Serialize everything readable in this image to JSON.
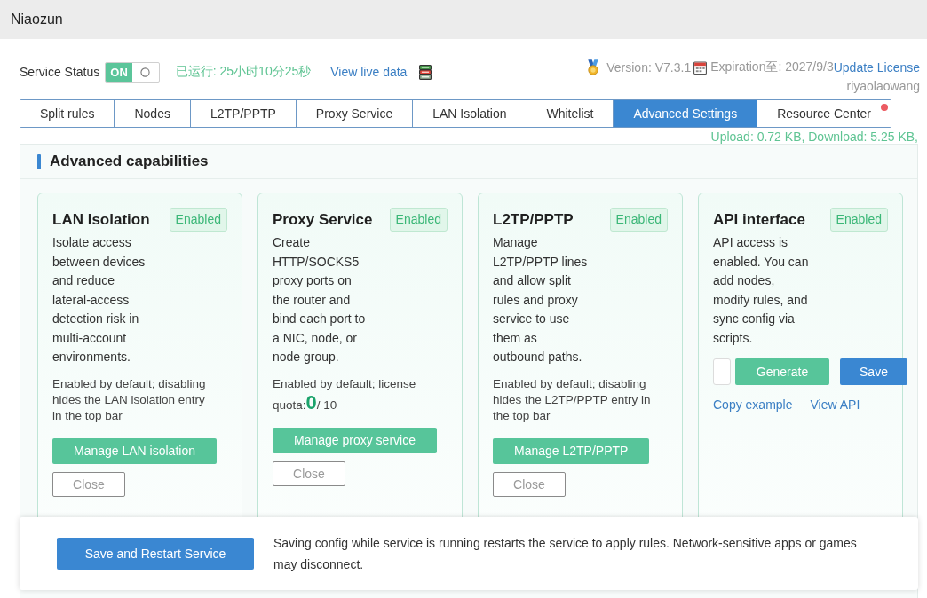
{
  "window": {
    "title": "Niaozun"
  },
  "status_bar": {
    "label": "Service Status",
    "toggle": {
      "on": true,
      "label": "ON"
    },
    "uptime": "已运行: 25小时10分25秒",
    "live_data_link": "View live data",
    "version": "Version: V7.3.1",
    "expiration": "Expiration至: 2027/9/3",
    "update_link": "Update License",
    "username": "riyaolaowang"
  },
  "tabs": [
    {
      "label": "Split rules",
      "selected": false,
      "notification": false
    },
    {
      "label": "Nodes",
      "selected": false,
      "notification": false
    },
    {
      "label": "L2TP/PPTP",
      "selected": false,
      "notification": false
    },
    {
      "label": "Proxy Service",
      "selected": false,
      "notification": false
    },
    {
      "label": "LAN Isolation",
      "selected": false,
      "notification": false
    },
    {
      "label": "Whitelist",
      "selected": false,
      "notification": false
    },
    {
      "label": "Advanced Settings",
      "selected": true,
      "notification": false
    },
    {
      "label": "Resource Center",
      "selected": false,
      "notification": true
    }
  ],
  "traffic": "Upload: 0.72 KB, Download: 5.25 KB,",
  "section": {
    "title": "Advanced capabilities",
    "cards": [
      {
        "kind": "feature",
        "title": "LAN Isolation",
        "badge": "Enabled",
        "description": "Isolate access between devices and reduce lateral-access detection risk in multi-account environments.",
        "note": "Enabled by default; disabling hides the LAN isolation entry in the top bar",
        "primary_button": "Manage LAN isolation",
        "close_button": "Close"
      },
      {
        "kind": "feature",
        "title": "Proxy Service",
        "badge": "Enabled",
        "description": "Create HTTP/SOCKS5 proxy ports on the router and bind each port to a NIC, node, or node group.",
        "note": "Enabled by default; license quota:",
        "quota": {
          "used": "0",
          "total": "/ 10"
        },
        "primary_button": "Manage proxy service",
        "close_button": "Close"
      },
      {
        "kind": "feature",
        "title": "L2TP/PPTP",
        "badge": "Enabled",
        "description": "Manage L2TP/PPTP lines and allow split rules and proxy service to use them as outbound paths.",
        "note": "Enabled by default; disabling hides the L2TP/PPTP entry in the top bar",
        "primary_button": "Manage L2TP/PPTP",
        "close_button": "Close"
      },
      {
        "kind": "api",
        "title": "API interface",
        "badge": "Enabled",
        "description": "API access is enabled. You can add nodes, modify rules, and sync config via scripts.",
        "generate_button": "Generate",
        "save_button": "Save",
        "links": [
          "Copy example",
          "View API"
        ]
      }
    ]
  },
  "footer": {
    "button": "Save and Restart Service",
    "message": "Saving config while service is running restarts the service to apply rules. Network-sensitive apps or games may disconnect."
  }
}
